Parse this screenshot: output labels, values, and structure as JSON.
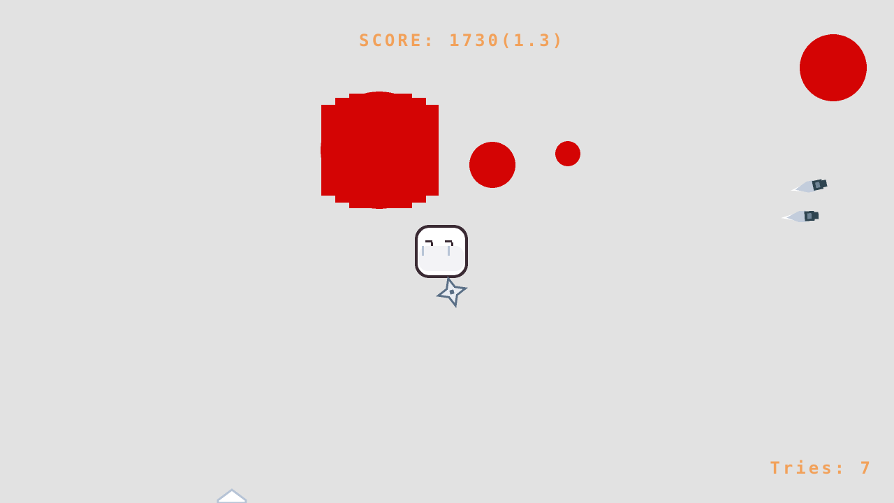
{
  "hud": {
    "score_label": "SCORE:",
    "score_value": "1730",
    "multiplier": "(1.3)",
    "tries_label": "Tries:",
    "tries_value": "7"
  },
  "colors": {
    "background": "#e2e2e2",
    "hud_text": "#f2a15a",
    "blob": "#d40404",
    "player_fill": "#ffffff",
    "player_outline": "#3a2a33",
    "enemy_body": "#c3cddc",
    "enemy_dark": "#2e4450"
  },
  "entities": {
    "player": "crying-ghost-icon",
    "player_weapon": "shuriken-icon",
    "enemies": [
      "dart-enemy-icon",
      "dart-enemy-icon"
    ],
    "hazards": [
      "red-blob",
      "red-blob",
      "red-blob",
      "red-blob"
    ],
    "pickup": "crystal-shard-icon"
  }
}
